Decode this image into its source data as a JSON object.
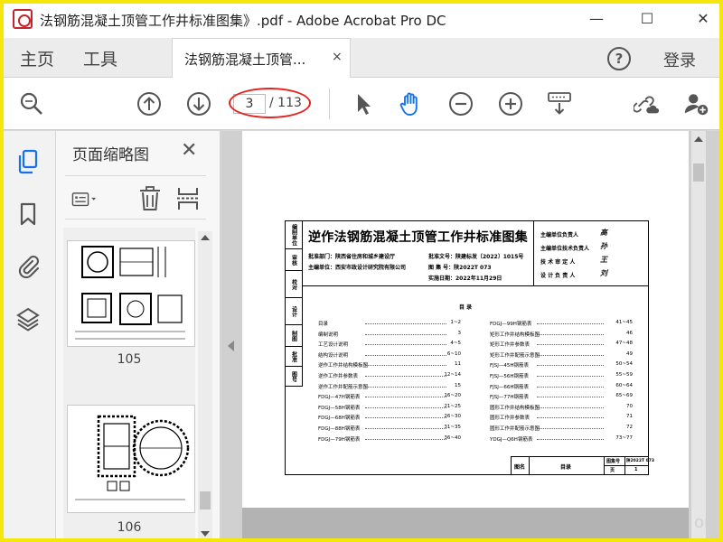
{
  "window": {
    "title": "法钢筋混凝土顶管工作井标准图集》.pdf - Adobe Acrobat Pro DC",
    "minimize": "—",
    "maximize": "☐",
    "close": "✕"
  },
  "tabs": {
    "home": "主页",
    "tools": "工具",
    "document": "法钢筋混凝土顶管...",
    "document_close": "×",
    "help": "?",
    "login": "登录"
  },
  "toolbar": {
    "current_page": "3",
    "total_pages": "/ 113"
  },
  "panel": {
    "title": "页面缩略图",
    "close": "✕",
    "thumbnails": [
      {
        "number": "105"
      },
      {
        "number": "106"
      }
    ]
  },
  "colors": {
    "annotation_oval": "#e32420",
    "frame": "#f5e70a",
    "accent_blue": "#1473e6"
  },
  "sheet": {
    "title": "逆作法钢筋混凝土顶管工作井标准图集",
    "side_labels": [
      "编制单位",
      "审核",
      "校对",
      "设计",
      "制图",
      "批准",
      "图号"
    ],
    "approval": {
      "dept": "批准部门：陕西省住房和城乡建设厅",
      "editor": "主编单位：西安市政设计研究院有限公司",
      "doc_no": "批准文号：陕建标发〔2022〕1015号",
      "atlas_no": "图 集 号：陕2022T 073",
      "date": "实施日期：2022年11月29日"
    },
    "responsible": [
      {
        "label": "主编单位负责人",
        "sign": "高"
      },
      {
        "label": "主编单位技术负责人",
        "sign": "孙"
      },
      {
        "label": "技 术 审 定 人",
        "sign": "王"
      },
      {
        "label": "设 计 负 责 人",
        "sign": "刘"
      }
    ],
    "toc_heading": "目    录",
    "toc_left": [
      {
        "label": "目录",
        "pages": "1~2"
      },
      {
        "label": "编制说明",
        "pages": "3"
      },
      {
        "label": "工艺设计说明",
        "pages": "4~5"
      },
      {
        "label": "结构设计说明",
        "pages": "6~10"
      },
      {
        "label": "逆作工作井结构模板图",
        "pages": "11"
      },
      {
        "label": "逆作工作井参数表",
        "pages": "12~14"
      },
      {
        "label": "逆作工作井配筋示意图",
        "pages": "15"
      },
      {
        "label": "FDGJ—47H钢筋表",
        "pages": "16~20"
      },
      {
        "label": "FDGJ—58H钢筋表",
        "pages": "21~25"
      },
      {
        "label": "FDGJ—68H钢筋表",
        "pages": "26~30"
      },
      {
        "label": "FDGJ—88H钢筋表",
        "pages": "31~35"
      },
      {
        "label": "FDGJ—79H钢筋表",
        "pages": "36~40"
      }
    ],
    "toc_right": [
      {
        "label": "FDGJ—99H钢筋表",
        "pages": "41~45"
      },
      {
        "label": "矩形工作井结构模板图",
        "pages": "46"
      },
      {
        "label": "矩形工作井参数表",
        "pages": "47~48"
      },
      {
        "label": "矩形工作井配筋示意图",
        "pages": "49"
      },
      {
        "label": "FJSJ—45H钢筋表",
        "pages": "50~54"
      },
      {
        "label": "FJSJ—56H钢筋表",
        "pages": "55~59"
      },
      {
        "label": "FJSJ—66H钢筋表",
        "pages": "60~64"
      },
      {
        "label": "FJSJ—77H钢筋表",
        "pages": "65~69"
      },
      {
        "label": "圆形工作井结构模板图",
        "pages": "70"
      },
      {
        "label": "圆形工作井参数表",
        "pages": "71"
      },
      {
        "label": "圆形工作井配筋示意图",
        "pages": "72"
      },
      {
        "label": "YDGJ—Q6H钢筋表",
        "pages": "73~77"
      }
    ],
    "titleblock": {
      "fig_name_label": "图名",
      "fig_name": "目录",
      "atlas_label": "图集号",
      "atlas": "陕2022T 073",
      "page_label": "页",
      "page": "1"
    }
  },
  "watermark": "om"
}
